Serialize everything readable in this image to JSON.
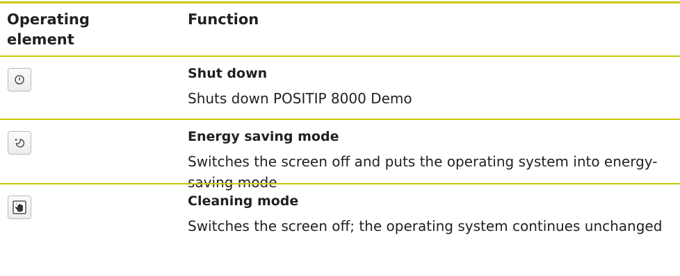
{
  "table": {
    "headers": [
      "Operating\nelement",
      "Function"
    ],
    "header_col1_line1": "Operating",
    "header_col1_line2": "element",
    "header_col2": "Function",
    "rows": [
      {
        "icon": "power-icon",
        "title": "Shut down",
        "description": "Shuts down POSITIP 8000 Demo"
      },
      {
        "icon": "moon-sleep-icon",
        "title": "Energy saving mode",
        "description": "Switches the screen off and puts the operating system into energy-saving mode"
      },
      {
        "icon": "cleaning-hand-icon",
        "title": "Cleaning mode",
        "description": "Switches the screen off; the operating system continues unchanged"
      }
    ]
  },
  "colors": {
    "rule": "#c8c800",
    "text": "#231f20"
  }
}
